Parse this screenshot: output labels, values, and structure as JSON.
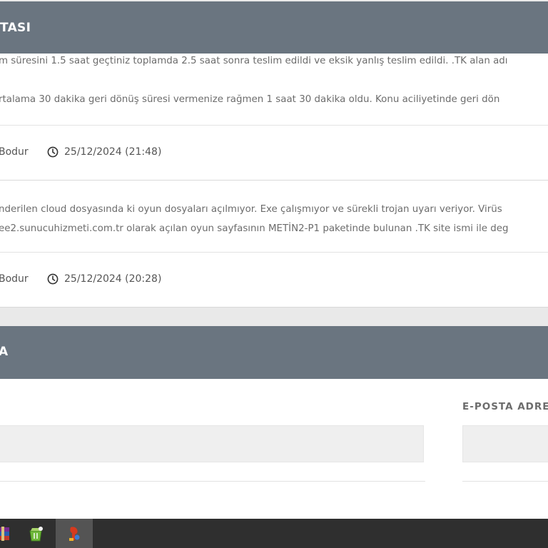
{
  "ticket_section": {
    "title": "TASI"
  },
  "messages": [
    {
      "line_1": "m süresini 1.5 saat geçtiniz toplamda 2.5 saat sonra teslim edildi ve eksik yanlış teslim edildi. .TK alan adı",
      "line_2": "rtalama 30 dakika geri dönüş süresi vermenize rağmen 1 saat 30 dakika oldu. Konu aciliyetinde geri dön",
      "author": "Bodur",
      "timestamp": "25/12/2024 (21:48)"
    },
    {
      "line_1": "nderilen cloud dosyasında ki oyun dosyaları açılmıyor. Exe çalışmıyor ve sürekli trojan uyarı veriyor. Virüs",
      "line_2": "ee2.sunucuhizmeti.com.tr olarak açılan oyun sayfasının METİN2-P1 paketinde bulunan .TK site ismi ile deg",
      "author": "Bodur",
      "timestamp": "25/12/2024 (20:28)"
    }
  ],
  "reply_section": {
    "title": "A",
    "email_label": "E-POSTA ADRE"
  },
  "taskbar": {
    "apps": [
      {
        "icon": "winrar-icon",
        "active": false
      },
      {
        "icon": "recycle-app-icon",
        "active": false
      },
      {
        "icon": "red-app-icon",
        "active": true
      }
    ]
  },
  "colors": {
    "header_bg": "#6a7580",
    "body_text": "#6c6c6c",
    "taskbar_bg": "#2f2f2f"
  }
}
